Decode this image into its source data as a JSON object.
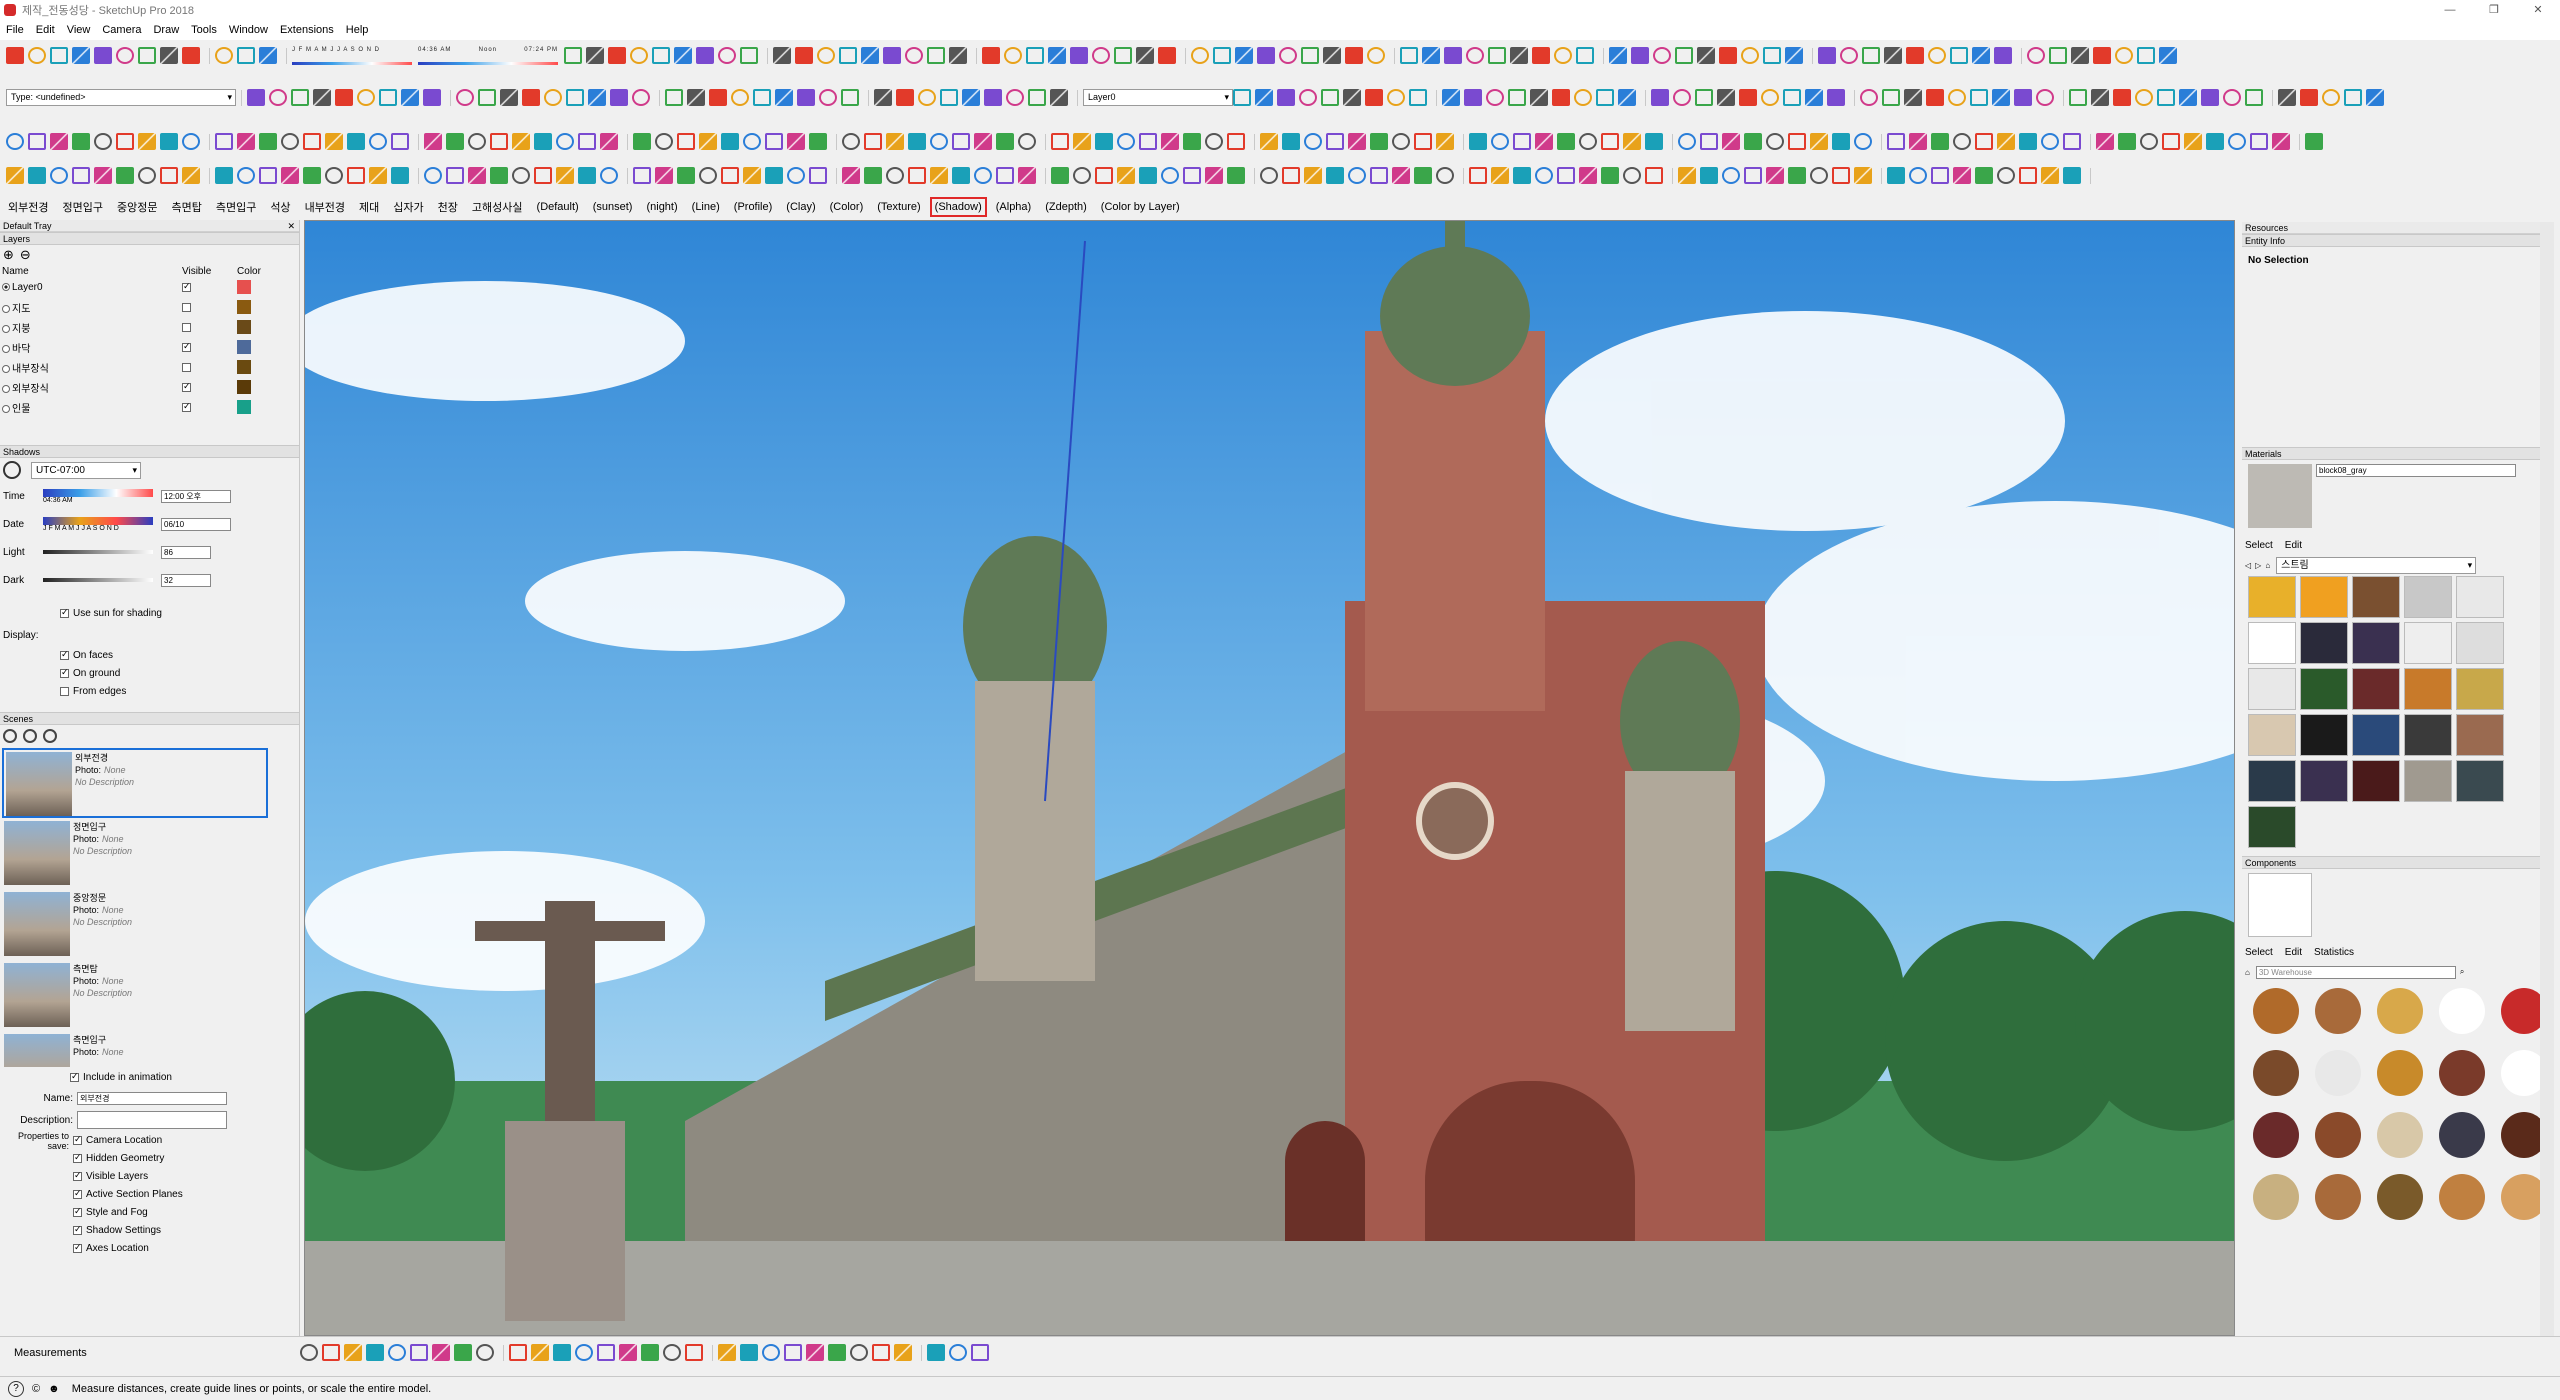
{
  "title": "제작_전동성당 - SketchUp Pro 2018",
  "window_controls": [
    "—",
    "❐",
    "✕"
  ],
  "menu": [
    "File",
    "Edit",
    "View",
    "Camera",
    "Draw",
    "Tools",
    "Window",
    "Extensions",
    "Help"
  ],
  "sun": {
    "months": "J F M A M J J A S O N D",
    "t1": "04:36 AM",
    "t2": "Noon",
    "t3": "07:24 PM"
  },
  "type_field": "Type: <undefined>",
  "layer_combo": "Layer0",
  "scene_tabs": [
    "외부전경",
    "정면입구",
    "중앙정문",
    "측면탑",
    "측면입구",
    "석상",
    "내부전경",
    "제대",
    "십자가",
    "천장",
    "고해성사실",
    "(Default)",
    "(sunset)",
    "(night)",
    "(Line)",
    "(Profile)",
    "(Clay)",
    "(Color)",
    "(Texture)",
    "(Shadow)",
    "(Alpha)",
    "(Zdepth)",
    "(Color by Layer)"
  ],
  "active_scene_tab": "(Shadow)",
  "left": {
    "tray_title": "Default Tray",
    "layers": {
      "title": "Layers",
      "cols": [
        "Name",
        "Visible",
        "Color"
      ],
      "rows": [
        {
          "name": "Layer0",
          "vis": true,
          "color": "#e6504e",
          "active": true
        },
        {
          "name": "지도",
          "vis": false,
          "color": "#8a5a10"
        },
        {
          "name": "지붕",
          "vis": false,
          "color": "#6a4a18"
        },
        {
          "name": "바닥",
          "vis": true,
          "color": "#4e6a9a"
        },
        {
          "name": "내부장식",
          "vis": false,
          "color": "#6a4a10"
        },
        {
          "name": "외부장식",
          "vis": true,
          "color": "#5a3a08"
        },
        {
          "name": "인물",
          "vis": true,
          "color": "#18a08a"
        }
      ]
    },
    "shadows": {
      "title": "Shadows",
      "tz": "UTC-07:00",
      "time_label": "Time",
      "time_t1": "04:36 AM",
      "time_t2": "Noon",
      "time_t3": "7:24 PM",
      "time_val": "12:00 오후",
      "date_label": "Date",
      "date_months": "J F M A M J J A S O N D",
      "date_val": "06/10",
      "light_label": "Light",
      "light_val": "86",
      "dark_label": "Dark",
      "dark_val": "32",
      "sun_shading": "Use sun for shading",
      "display_label": "Display:",
      "on_faces": "On faces",
      "on_ground": "On ground",
      "from_edges": "From edges"
    },
    "scenes": {
      "title": "Scenes",
      "items": [
        {
          "name": "외부전경",
          "photo": "Photo:",
          "photo_val": "None",
          "desc": "No Description",
          "sel": true
        },
        {
          "name": "정면입구",
          "photo": "Photo:",
          "photo_val": "None",
          "desc": "No Description"
        },
        {
          "name": "중앙정문",
          "photo": "Photo:",
          "photo_val": "None",
          "desc": "No Description"
        },
        {
          "name": "측면탑",
          "photo": "Photo:",
          "photo_val": "None",
          "desc": "No Description"
        },
        {
          "name": "측면입구",
          "photo": "Photo:",
          "photo_val": "None",
          "desc": ""
        }
      ],
      "include": "Include in animation",
      "name_label": "Name:",
      "name_val": "외부전경",
      "desc_label": "Description:",
      "props_label": "Properties to save:",
      "props": [
        "Camera Location",
        "Hidden Geometry",
        "Visible Layers",
        "Active Section Planes",
        "Style and Fog",
        "Shadow Settings",
        "Axes Location"
      ]
    }
  },
  "right": {
    "resources": "Resources",
    "entity_info": "Entity Info",
    "no_selection": "No Selection",
    "materials": "Materials",
    "mat_name": "block08_gray",
    "select": "Select",
    "edit": "Edit",
    "mat_lib": "스트림",
    "components": "Components",
    "statistics": "Statistics",
    "warehouse": "3D Warehouse"
  },
  "measurements": "Measurements",
  "status": "Measure distances, create guide lines or points, or scale the entire model.",
  "colors": {
    "accent": "#1a6fd8",
    "highlight": "#e02828"
  }
}
